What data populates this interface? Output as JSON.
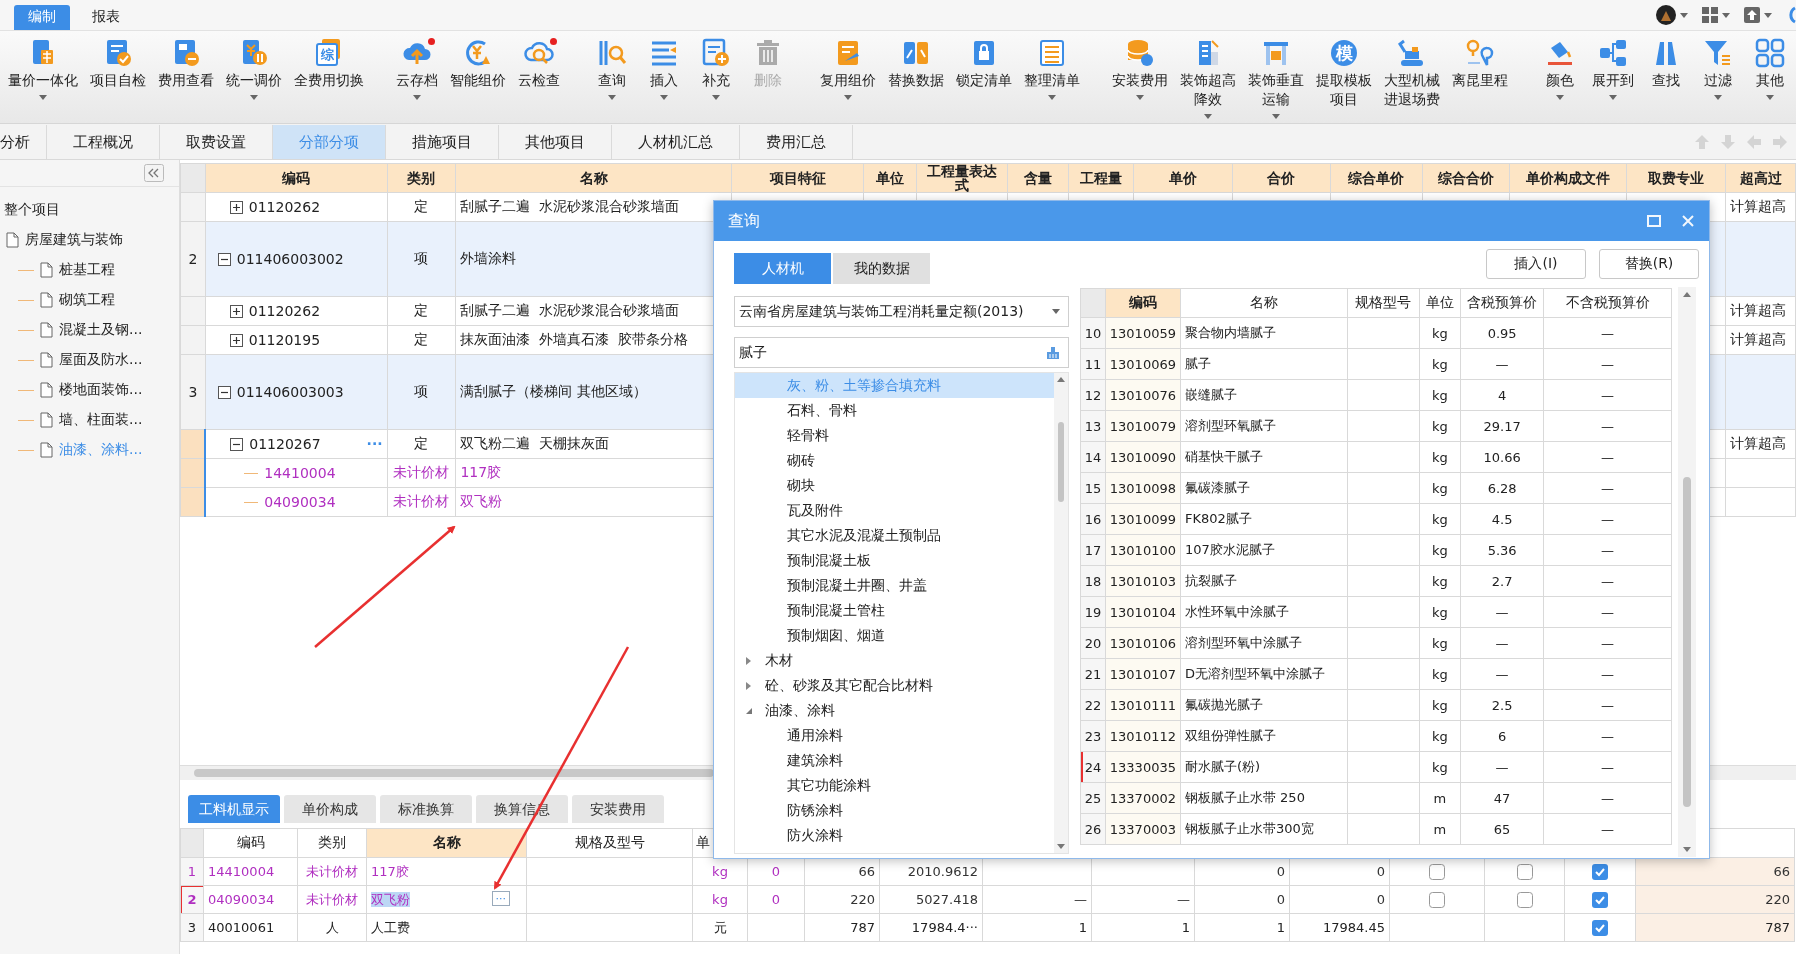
{
  "menu_tabs": [
    {
      "label": "编制",
      "selected": true
    },
    {
      "label": "报表",
      "selected": false
    }
  ],
  "toolbar": [
    [
      {
        "label": [
          "量价一体化"
        ],
        "dropdown": true,
        "disabled": false
      },
      {
        "label": [
          "项目自检"
        ],
        "dropdown": false,
        "disabled": false
      },
      {
        "label": [
          "费用查看"
        ],
        "dropdown": false,
        "disabled": false
      },
      {
        "label": [
          "统一调价"
        ],
        "dropdown": true,
        "disabled": false
      },
      {
        "label": [
          "全费用切换"
        ],
        "dropdown": false,
        "disabled": false,
        "icon_text": "综"
      }
    ],
    [
      {
        "label": [
          "云存档"
        ],
        "dropdown": true,
        "disabled": false,
        "badge": true
      },
      {
        "label": [
          "智能组价"
        ],
        "dropdown": false,
        "disabled": false
      },
      {
        "label": [
          "云检查"
        ],
        "dropdown": false,
        "disabled": false,
        "badge": true
      }
    ],
    [
      {
        "label": [
          "查询"
        ],
        "dropdown": true,
        "disabled": false
      },
      {
        "label": [
          "插入"
        ],
        "dropdown": true,
        "disabled": false
      },
      {
        "label": [
          "补充"
        ],
        "dropdown": true,
        "disabled": false
      },
      {
        "label": [
          "删除"
        ],
        "dropdown": false,
        "disabled": true
      }
    ],
    [
      {
        "label": [
          "复用组价"
        ],
        "dropdown": true,
        "disabled": false
      },
      {
        "label": [
          "替换数据"
        ],
        "dropdown": false,
        "disabled": false
      },
      {
        "label": [
          "锁定清单"
        ],
        "dropdown": false,
        "disabled": false
      },
      {
        "label": [
          "整理清单"
        ],
        "dropdown": true,
        "disabled": false
      }
    ],
    [
      {
        "label": [
          "安装费用"
        ],
        "dropdown": true,
        "disabled": false
      },
      {
        "label": [
          "装饰超高",
          "降效"
        ],
        "dropdown": true,
        "disabled": false
      },
      {
        "label": [
          "装饰垂直",
          "运输"
        ],
        "dropdown": true,
        "disabled": false
      },
      {
        "label": [
          "提取模板",
          "项目"
        ],
        "dropdown": false,
        "disabled": false,
        "icon_text": "模"
      },
      {
        "label": [
          "大型机械",
          "进退场费"
        ],
        "dropdown": false,
        "disabled": false
      },
      {
        "label": [
          "离昆里程"
        ],
        "dropdown": false,
        "disabled": false
      }
    ],
    [
      {
        "label": [
          "颜色"
        ],
        "dropdown": true,
        "disabled": false
      },
      {
        "label": [
          "展开到"
        ],
        "dropdown": true,
        "disabled": false
      },
      {
        "label": [
          "查找"
        ],
        "dropdown": false,
        "disabled": false
      },
      {
        "label": [
          "过滤"
        ],
        "dropdown": true,
        "disabled": false
      },
      {
        "label": [
          "其他"
        ],
        "dropdown": true,
        "disabled": false
      }
    ]
  ],
  "view_tabs": [
    {
      "label": "分析",
      "selected": false
    },
    {
      "label": "工程概况",
      "selected": false
    },
    {
      "label": "取费设置",
      "selected": false
    },
    {
      "label": "分部分项",
      "selected": true
    },
    {
      "label": "措施项目",
      "selected": false
    },
    {
      "label": "其他项目",
      "selected": false
    },
    {
      "label": "人材机汇总",
      "selected": false
    },
    {
      "label": "费用汇总",
      "selected": false
    }
  ],
  "project_tree": {
    "root": "整个项目",
    "items": [
      {
        "label": "房屋建筑与装饰",
        "selected": false,
        "children": [
          {
            "label": "桩基工程",
            "selected": false
          },
          {
            "label": "砌筑工程",
            "selected": false
          },
          {
            "label": "混凝土及钢...",
            "selected": false
          },
          {
            "label": "屋面及防水...",
            "selected": false
          },
          {
            "label": "楼地面装饰...",
            "selected": false
          },
          {
            "label": "墙、柱面装...",
            "selected": false
          },
          {
            "label": "油漆、涂料...",
            "selected": true
          }
        ]
      }
    ]
  },
  "bill_table": {
    "columns": [
      "编码",
      "类别",
      "名称",
      "项目特征",
      "单位",
      "工程量表达式",
      "含量",
      "工程量",
      "单价",
      "合价",
      "综合单价",
      "综合合价",
      "单价构成文件",
      "取费专业",
      "超高过"
    ],
    "rows_continued": [
      {
        "kind": "de",
        "selected": false,
        "code": "01120262",
        "expanded": false,
        "type": "定",
        "name": "刮腻子二遍  水泥砂浆混合砂浆墙面",
        "over_height": "计算超高"
      }
    ],
    "rows": [
      {
        "kind": "item",
        "selected": false,
        "num": "2",
        "code": "011406003002",
        "expanded": true,
        "type": "项",
        "name": "外墙涂料",
        "children": [
          {
            "kind": "de",
            "selected": false,
            "code": "01120262",
            "expanded": false,
            "type": "定",
            "name": "刮腻子二遍  水泥砂浆混合砂浆墙面",
            "over_height": "计算超高"
          },
          {
            "kind": "de",
            "selected": false,
            "code": "01120195",
            "expanded": false,
            "type": "定",
            "name": "抹灰面油漆  外墙真石漆  胶带条分格",
            "over_height": "计算超高"
          }
        ]
      },
      {
        "kind": "item",
        "selected": false,
        "num": "3",
        "code": "011406003003",
        "expanded": true,
        "type": "项",
        "name": "满刮腻子（楼梯间 其他区域）",
        "children": [
          {
            "kind": "de",
            "selected": true,
            "code": "01120267",
            "more": "···",
            "expanded": true,
            "type": "定",
            "name": "双飞粉二遍  天棚抹灰面",
            "over_height": "计算超高",
            "children": [
              {
                "kind": "material",
                "selected": false,
                "code": "14410004",
                "type": "未计价材",
                "name": "117胶"
              },
              {
                "kind": "material",
                "selected": false,
                "code": "04090034",
                "type": "未计价材",
                "name": "双飞粉"
              }
            ]
          }
        ]
      }
    ]
  },
  "resource_panel": {
    "tabs": [
      {
        "label": "工料机显示",
        "selected": true
      },
      {
        "label": "单价构成",
        "selected": false
      },
      {
        "label": "标准换算",
        "selected": false
      },
      {
        "label": "换算信息",
        "selected": false
      },
      {
        "label": "安装费用",
        "selected": false
      }
    ],
    "columns": [
      "编码",
      "类别",
      "名称",
      "规格及型号",
      "单"
    ],
    "rows": [
      {
        "num": "1",
        "selected": false,
        "highlighted": false,
        "editing": false,
        "kind": "material",
        "code": "14410004",
        "type": "未计价材",
        "name": "117胶",
        "unit": "kg",
        "column_7": "0",
        "column_8": "66",
        "column_9": "2010.9612",
        "column_12": "0",
        "column_13": "0",
        "column_14": {
          "checked": false
        },
        "column_15": {
          "checked": false
        },
        "column_16": {
          "checked": true
        },
        "column_17": "66"
      },
      {
        "num": "2",
        "selected": true,
        "highlighted": true,
        "editing": true,
        "more": "···",
        "kind": "material",
        "code": "04090034",
        "type": "未计价材",
        "name": "双飞粉",
        "unit": "kg",
        "column_7": "0",
        "column_8": "220",
        "column_9": "5027.418",
        "column_10": "—",
        "column_11": "—",
        "column_12": "0",
        "column_13": "0",
        "column_14": {
          "checked": false
        },
        "column_15": {
          "checked": false
        },
        "column_16": {
          "checked": true
        },
        "column_17": "220"
      },
      {
        "num": "3",
        "selected": false,
        "highlighted": false,
        "editing": false,
        "kind": "labor",
        "code": "40010061",
        "type": "人",
        "name": "人工费",
        "unit": "元",
        "column_8": "787",
        "column_9": "17984.4···",
        "column_10": "1",
        "column_11": "1",
        "column_12": "1",
        "column_13": "17984.45",
        "column_16": {
          "checked": true
        },
        "column_17": "787"
      }
    ]
  },
  "query_dialog": {
    "title": "查询",
    "tabs": [
      {
        "label": "人材机",
        "selected": true
      },
      {
        "label": "我的数据",
        "selected": false
      }
    ],
    "buttons": [
      "插入(I)",
      "替换(R)"
    ],
    "library": "云南省房屋建筑与装饰工程消耗量定额(2013)",
    "search": "腻子",
    "category_tree": {
      "continued_children": [
        {
          "label": "灰、粉、土等掺合填充料",
          "selected": true
        },
        {
          "label": "石料、骨料",
          "selected": false
        },
        {
          "label": "轻骨料",
          "selected": false
        },
        {
          "label": "砌砖",
          "selected": false
        },
        {
          "label": "砌块",
          "selected": false
        },
        {
          "label": "瓦及附件",
          "selected": false
        },
        {
          "label": "其它水泥及混凝土预制品",
          "selected": false
        },
        {
          "label": "预制混凝土板",
          "selected": false
        },
        {
          "label": "预制混凝土井圈、井盖",
          "selected": false
        },
        {
          "label": "预制混凝土管柱",
          "selected": false
        },
        {
          "label": "预制烟囱、烟道",
          "selected": false
        }
      ],
      "items": [
        {
          "label": "木材",
          "selected": false,
          "expanded": false
        },
        {
          "label": "砼、砂浆及其它配合比材料",
          "selected": false,
          "expanded": false
        },
        {
          "label": "油漆、涂料",
          "selected": false,
          "expanded": true,
          "children": [
            {
              "label": "通用涂料",
              "selected": false
            },
            {
              "label": "建筑涂料",
              "selected": false
            },
            {
              "label": "其它功能涂料",
              "selected": false
            },
            {
              "label": "防锈涂料",
              "selected": false
            },
            {
              "label": "防火涂料",
              "selected": false
            }
          ]
        }
      ]
    },
    "columns": [
      {
        "label": "编码",
        "selected": true
      },
      {
        "label": "名称",
        "selected": false
      },
      {
        "label": "规格型号",
        "selected": false
      },
      {
        "label": "单位",
        "selected": false
      },
      {
        "label": "含税预算价",
        "selected": false
      },
      {
        "label": "不含税预算价",
        "selected": false
      }
    ],
    "rows": [
      {
        "num": "10",
        "code": "13010059",
        "name": "聚合物内墙腻子",
        "unit": "kg",
        "tax_price": "0.95",
        "net_price": "—",
        "highlighted": false
      },
      {
        "num": "11",
        "code": "13010069",
        "name": "腻子",
        "unit": "kg",
        "tax_price": "—",
        "net_price": "—",
        "highlighted": false
      },
      {
        "num": "12",
        "code": "13010076",
        "name": "嵌缝腻子",
        "unit": "kg",
        "tax_price": "4",
        "net_price": "—",
        "highlighted": false
      },
      {
        "num": "13",
        "code": "13010079",
        "name": "溶剂型环氧腻子",
        "unit": "kg",
        "tax_price": "29.17",
        "net_price": "—",
        "highlighted": false
      },
      {
        "num": "14",
        "code": "13010090",
        "name": "硝基快干腻子",
        "unit": "kg",
        "tax_price": "10.66",
        "net_price": "—",
        "highlighted": false
      },
      {
        "num": "15",
        "code": "13010098",
        "name": "氟碳漆腻子",
        "unit": "kg",
        "tax_price": "6.28",
        "net_price": "—",
        "highlighted": false
      },
      {
        "num": "16",
        "code": "13010099",
        "name": "FK802腻子",
        "unit": "kg",
        "tax_price": "4.5",
        "net_price": "—",
        "highlighted": false
      },
      {
        "num": "17",
        "code": "13010100",
        "name": "107胶水泥腻子",
        "unit": "kg",
        "tax_price": "5.36",
        "net_price": "—",
        "highlighted": false
      },
      {
        "num": "18",
        "code": "13010103",
        "name": "抗裂腻子",
        "unit": "kg",
        "tax_price": "2.7",
        "net_price": "—",
        "highlighted": false
      },
      {
        "num": "19",
        "code": "13010104",
        "name": "水性环氧中涂腻子",
        "unit": "kg",
        "tax_price": "—",
        "net_price": "—",
        "highlighted": false
      },
      {
        "num": "20",
        "code": "13010106",
        "name": "溶剂型环氧中涂腻子",
        "unit": "kg",
        "tax_price": "—",
        "net_price": "—",
        "highlighted": false
      },
      {
        "num": "21",
        "code": "13010107",
        "name": "D无溶剂型环氧中涂腻子",
        "unit": "kg",
        "tax_price": "—",
        "net_price": "—",
        "highlighted": false
      },
      {
        "num": "22",
        "code": "13010111",
        "name": "氟碳抛光腻子",
        "unit": "kg",
        "tax_price": "2.5",
        "net_price": "—",
        "highlighted": false
      },
      {
        "num": "23",
        "code": "13010112",
        "name": "双组份弹性腻子",
        "unit": "kg",
        "tax_price": "6",
        "net_price": "—",
        "highlighted": false
      },
      {
        "num": "24",
        "code": "13330035",
        "name": "耐水腻子(粉)",
        "unit": "kg",
        "tax_price": "—",
        "net_price": "—",
        "highlighted": true
      },
      {
        "num": "25",
        "code": "13370002",
        "name": "钢板腻子止水带 250",
        "unit": "m",
        "tax_price": "47",
        "net_price": "—",
        "highlighted": false
      },
      {
        "num": "26",
        "code": "13370003",
        "name": "钢板腻子止水带300宽",
        "unit": "m",
        "tax_price": "65",
        "net_price": "—",
        "highlighted": false
      }
    ]
  }
}
